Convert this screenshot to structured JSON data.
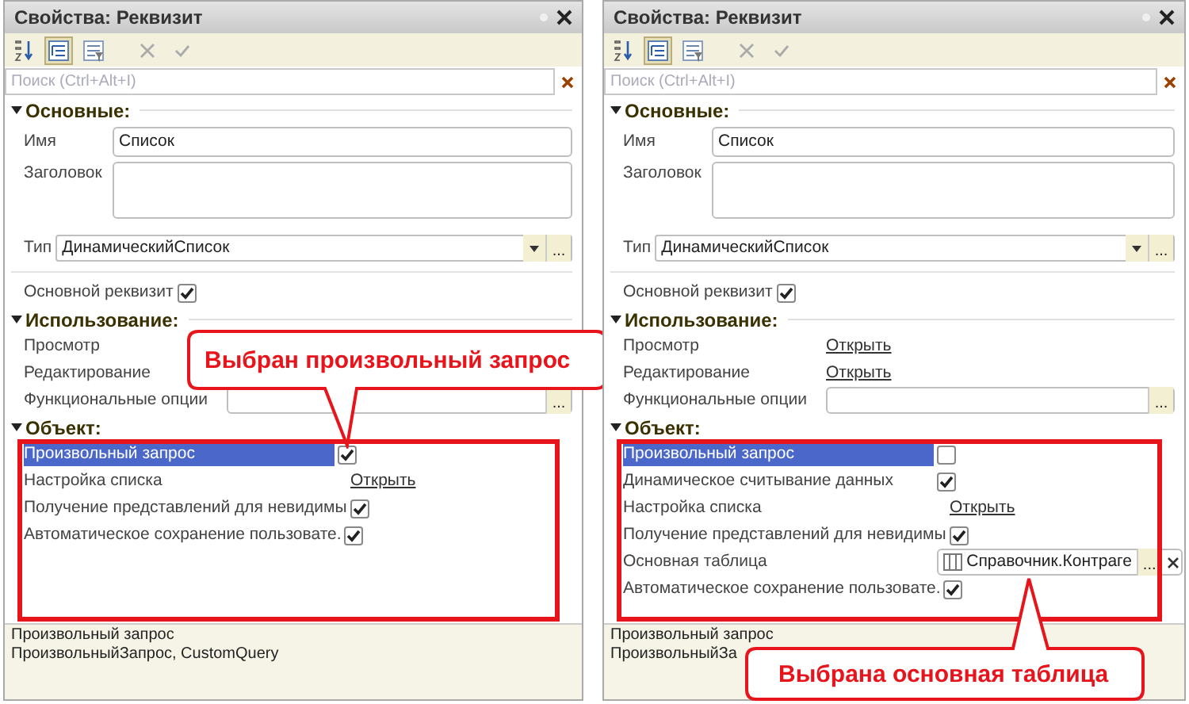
{
  "panels": [
    {
      "title": "Свойства: Реквизит",
      "search": {
        "placeholder": "Поиск (Ctrl+Alt+I)"
      },
      "sections": [
        {
          "kind": "main",
          "title": "Основные:",
          "expanded": true,
          "rows": [
            {
              "kind": "text",
              "label": "Имя",
              "value": "Список"
            },
            {
              "kind": "textarea",
              "label": "Заголовок"
            },
            {
              "kind": "select",
              "label": "Тип",
              "value": "ДинамическийСписок",
              "button": "..."
            },
            {
              "kind": "checkbox",
              "label": "Основной реквизит",
              "checked": true
            }
          ]
        },
        {
          "kind": "usage",
          "title": "Использование:",
          "expanded": true,
          "rows": [
            {
              "kind": "blank",
              "label": "Просмотр"
            },
            {
              "kind": "blank",
              "label": "Редактирование"
            },
            {
              "kind": "ellipsis-field",
              "label": "Функциональные опции",
              "button": "..."
            }
          ]
        },
        {
          "kind": "object",
          "title": "Объект:",
          "expanded": true,
          "rows": [
            {
              "kind": "checkbox",
              "label": "Произвольный запрос",
              "checked": true,
              "selected": true
            },
            {
              "kind": "link",
              "label": "Настройка списка",
              "value": "Открыть",
              "selected": false
            },
            {
              "kind": "checkbox",
              "label": "Получение представлений для невидимы",
              "checked": true,
              "selected": false
            },
            {
              "kind": "checkbox",
              "label": "Автоматическое сохранение пользовате.",
              "checked": true,
              "selected": false
            }
          ]
        }
      ],
      "description": [
        "Произвольный запрос",
        "ПроизвольныйЗапрос, CustomQuery"
      ],
      "callout": {
        "text": "Выбран произвольный запрос"
      }
    },
    {
      "title": "Свойства: Реквизит",
      "search": {
        "placeholder": "Поиск (Ctrl+Alt+I)"
      },
      "sections": [
        {
          "kind": "main",
          "title": "Основные:",
          "expanded": true,
          "rows": [
            {
              "kind": "text",
              "label": "Имя",
              "value": "Список"
            },
            {
              "kind": "textarea",
              "label": "Заголовок"
            },
            {
              "kind": "select",
              "label": "Тип",
              "value": "ДинамическийСписок",
              "button": "..."
            },
            {
              "kind": "checkbox",
              "label": "Основной реквизит",
              "checked": true
            }
          ]
        },
        {
          "kind": "usage",
          "title": "Использование:",
          "expanded": true,
          "rows": [
            {
              "kind": "link",
              "label": "Просмотр",
              "value": "Открыть"
            },
            {
              "kind": "link",
              "label": "Редактирование",
              "value": "Открыть"
            },
            {
              "kind": "ellipsis-field",
              "label": "Функциональные опции",
              "button": "..."
            }
          ]
        },
        {
          "kind": "object",
          "title": "Объект:",
          "expanded": true,
          "rows": [
            {
              "kind": "checkbox",
              "label": "Произвольный запрос",
              "checked": false,
              "selected": true
            },
            {
              "kind": "checkbox",
              "label": "Динамическое считывание данных",
              "checked": true,
              "selected": false
            },
            {
              "kind": "link",
              "label": "Настройка списка",
              "value": "Открыть",
              "selected": false
            },
            {
              "kind": "checkbox",
              "label": "Получение представлений для невидимы",
              "checked": true,
              "selected": false
            },
            {
              "kind": "ref-field",
              "label": "Основная таблица",
              "value": "Справочник.Контраге",
              "button": "...",
              "selected": false
            },
            {
              "kind": "checkbox",
              "label": "Автоматическое сохранение пользовате.",
              "checked": true,
              "selected": false
            }
          ]
        }
      ],
      "description": [
        "Произвольный запрос",
        "ПроизвольныйЗа"
      ],
      "callout": {
        "text": "Выбрана основная таблица"
      }
    }
  ]
}
